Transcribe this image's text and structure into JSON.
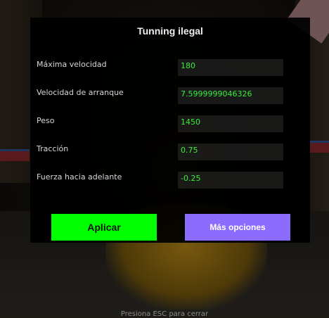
{
  "dialog": {
    "title": "Tunning ilegal",
    "fields": [
      {
        "label": "Máxima velocidad",
        "value": "180"
      },
      {
        "label": "Velocidad de arranque",
        "value": "7.5999999046326"
      },
      {
        "label": "Peso",
        "value": "1450"
      },
      {
        "label": "Tracción",
        "value": "0.75"
      },
      {
        "label": "Fuerza hacia adelante",
        "value": "-0.25"
      }
    ],
    "apply_label": "Aplicar",
    "more_label": "Más opciones"
  },
  "footer": {
    "hint": "Presiona ESC para cerrar"
  },
  "colors": {
    "panel_bg": "#000000",
    "field_bg": "#1a1a1a",
    "field_text": "#3cff3c",
    "apply_bg": "#00ff00",
    "more_bg": "#8c6cff"
  }
}
